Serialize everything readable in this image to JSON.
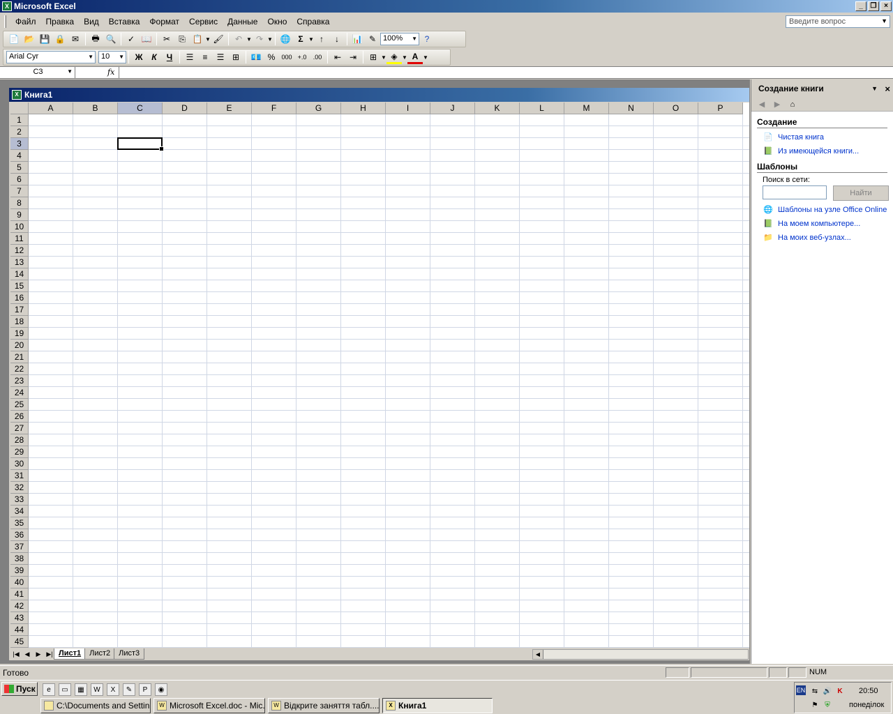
{
  "window": {
    "title": "Microsoft Excel"
  },
  "menu": [
    "Файл",
    "Правка",
    "Вид",
    "Вставка",
    "Формат",
    "Сервис",
    "Данные",
    "Окно",
    "Справка"
  ],
  "help_box": {
    "placeholder": "Введите вопрос"
  },
  "toolbar": {
    "zoom": "100%",
    "font_name": "Arial Cyr",
    "font_size": "10",
    "bold": "Ж",
    "italic": "К",
    "underline": "Ч",
    "sigma": "Σ",
    "percent": "%",
    "thousands": "000"
  },
  "formula_bar": {
    "name_box": "C3",
    "fx": "fx",
    "value": ""
  },
  "workbook": {
    "title": "Книга1",
    "active_cell": "C3"
  },
  "columns": [
    "A",
    "B",
    "C",
    "D",
    "E",
    "F",
    "G",
    "H",
    "I",
    "J",
    "K",
    "L",
    "M",
    "N",
    "O",
    "P"
  ],
  "rows": [
    "1",
    "2",
    "3",
    "4",
    "5",
    "6",
    "7",
    "8",
    "9",
    "10",
    "11",
    "12",
    "13",
    "14",
    "15",
    "16",
    "17",
    "18",
    "19",
    "20",
    "21",
    "22",
    "23",
    "24",
    "25",
    "26",
    "27",
    "28",
    "29",
    "30",
    "31",
    "32",
    "33",
    "34",
    "35",
    "36",
    "37",
    "38",
    "39",
    "40",
    "41",
    "42",
    "43",
    "44",
    "45"
  ],
  "sheets": [
    "Лист1",
    "Лист2",
    "Лист3"
  ],
  "active_sheet": "Лист1",
  "task_pane": {
    "title": "Создание книги",
    "section_create": "Создание",
    "link_blank": "Чистая книга",
    "link_existing": "Из имеющейся книги...",
    "section_templates": "Шаблоны",
    "search_label": "Поиск в сети:",
    "search_button": "Найти",
    "link_online": "Шаблоны на узле Office Online",
    "link_computer": "На моем компьютере...",
    "link_web": "На моих веб-узлах..."
  },
  "status": {
    "ready": "Готово",
    "num": "NUM"
  },
  "taskbar": {
    "start": "Пуск",
    "buttons": [
      "C:\\Documents and Settin...",
      "Microsoft Excel.doc - Mic...",
      "Відкрите заняття табл....",
      "Книга1"
    ],
    "lang": "EN",
    "time": "20:50",
    "day": "понеділок"
  }
}
